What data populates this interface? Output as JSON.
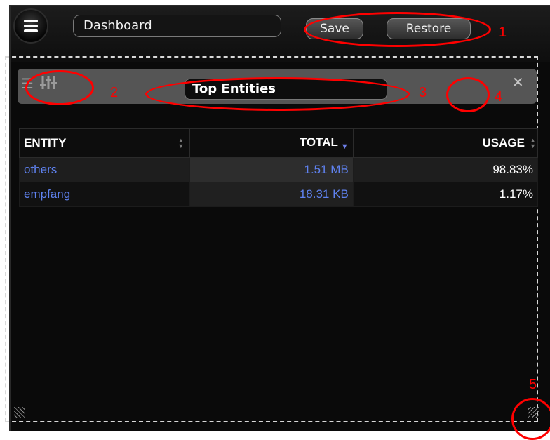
{
  "toolbar": {
    "dashboard_name": "Dashboard",
    "save_label": "Save",
    "restore_label": "Restore"
  },
  "widget": {
    "title": "Top Entities",
    "close_glyph": "✕"
  },
  "table": {
    "columns": [
      "ENTITY",
      "TOTAL",
      "USAGE"
    ],
    "sorted_column": "TOTAL",
    "sort_direction": "descending",
    "rows": [
      {
        "entity": "others",
        "total": "1.51 MB",
        "usage": "98.83%"
      },
      {
        "entity": "empfang",
        "total": "18.31 KB",
        "usage": "1.17%"
      }
    ]
  },
  "annotations": [
    "1",
    "2",
    "3",
    "4",
    "5"
  ],
  "icons": {
    "menu": "hamburger-menu-icon",
    "widget_menu": "list-icon",
    "widget_settings": "sliders-icon",
    "close": "close-icon",
    "resize": "resize-handle-icon"
  },
  "colors": {
    "background": "#0a0a0a",
    "link": "#5f82f0",
    "annotation": "#ff0000",
    "widget_header": "#555555"
  }
}
